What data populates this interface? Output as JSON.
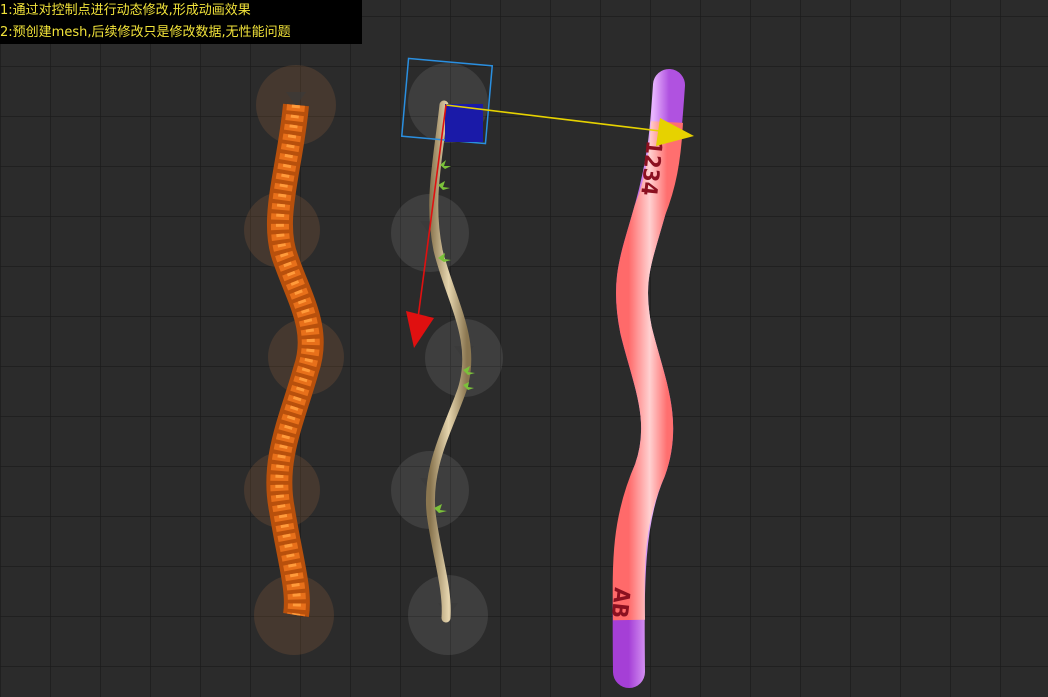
{
  "info": {
    "line1": "1:通过对控制点进行动态修改,形成动画效果",
    "line2": "2:预创建mesh,后续修改只是修改数据,无性能问题"
  },
  "tube": {
    "label_top": "1234",
    "label_bottom": "AB"
  },
  "colors": {
    "background": "#2b2b2b",
    "grid": "#1c1c1c",
    "info_text": "#f2e33a",
    "rope_orange": "#e8701a",
    "vine": "#c9b48a",
    "leaf": "#7bc13a",
    "tube_pink": "#ff7f7f",
    "tube_cap": "#b84fe0",
    "gizmo_x": "#e6d200",
    "gizmo_y": "#e01010",
    "gizmo_box": "#1a1aa8",
    "gizmo_frame": "#2a8fe0"
  }
}
